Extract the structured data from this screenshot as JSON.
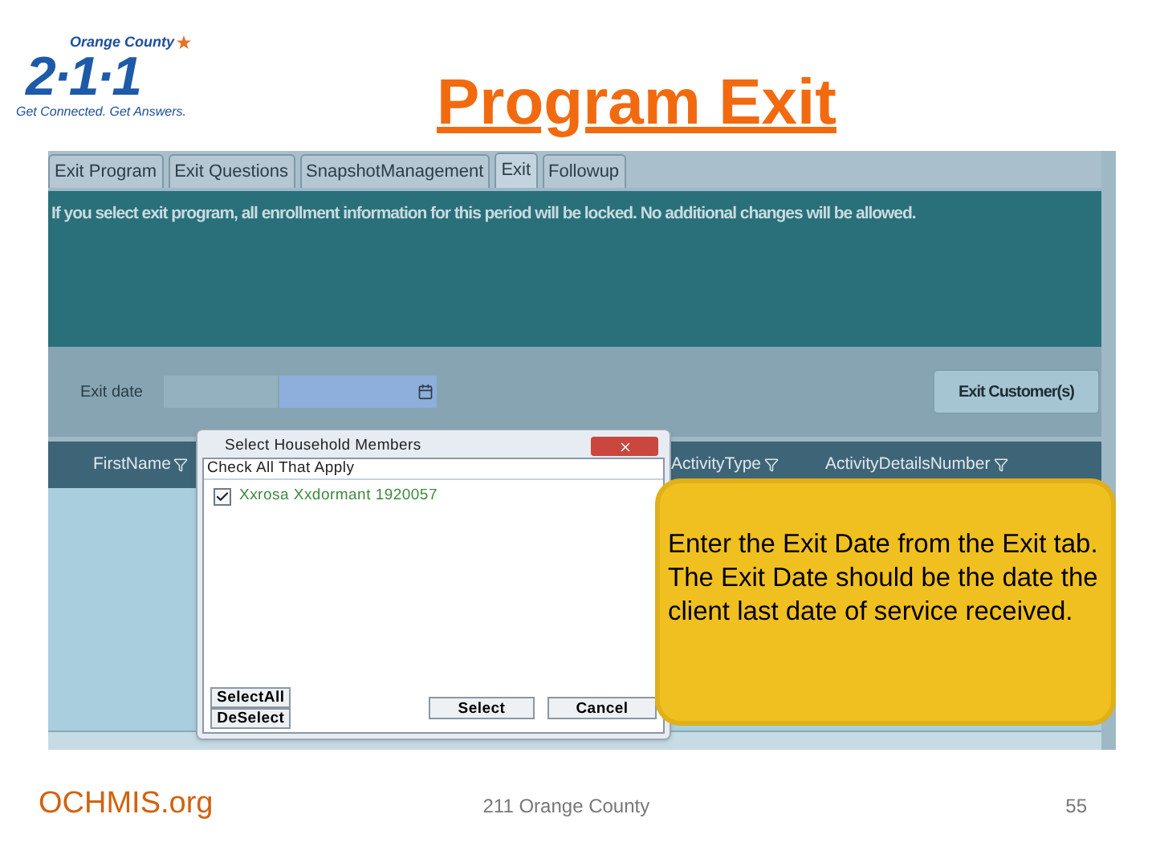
{
  "logo": {
    "region": "Orange County",
    "mark": "2·1·1",
    "tagline": "Get Connected. Get Answers."
  },
  "title": "Program Exit",
  "app": {
    "tabs": [
      {
        "label": "Exit Program",
        "selected": false
      },
      {
        "label": "Exit Questions",
        "selected": false
      },
      {
        "label": "SnapshotManagement",
        "selected": false
      },
      {
        "label": "Exit",
        "selected": true
      },
      {
        "label": "Followup",
        "selected": false
      }
    ],
    "notice": "If you select exit program, all enrollment information for this period will be locked. No additional changes will be allowed.",
    "exit_date_label": "Exit date",
    "exit_button": "Exit Customer(s)",
    "grid_columns": [
      {
        "label": "FirstName"
      },
      {
        "label": "ActivityType"
      },
      {
        "label": "ActivityDetailsNumber"
      }
    ]
  },
  "dialog": {
    "title": "Select Household Members",
    "heading": "Check All That Apply",
    "members": [
      {
        "name": "Xxrosa Xxdormant 1920057",
        "checked": true
      }
    ],
    "select_all": "SelectAll",
    "deselect": "DeSelect",
    "select": "Select",
    "cancel": "Cancel"
  },
  "callout": "Enter the Exit Date from the Exit tab.  The Exit Date should be the date the client last date of service received.",
  "footer": {
    "site": "OCHMIS.org",
    "org": "211 Orange County",
    "page": "55"
  }
}
